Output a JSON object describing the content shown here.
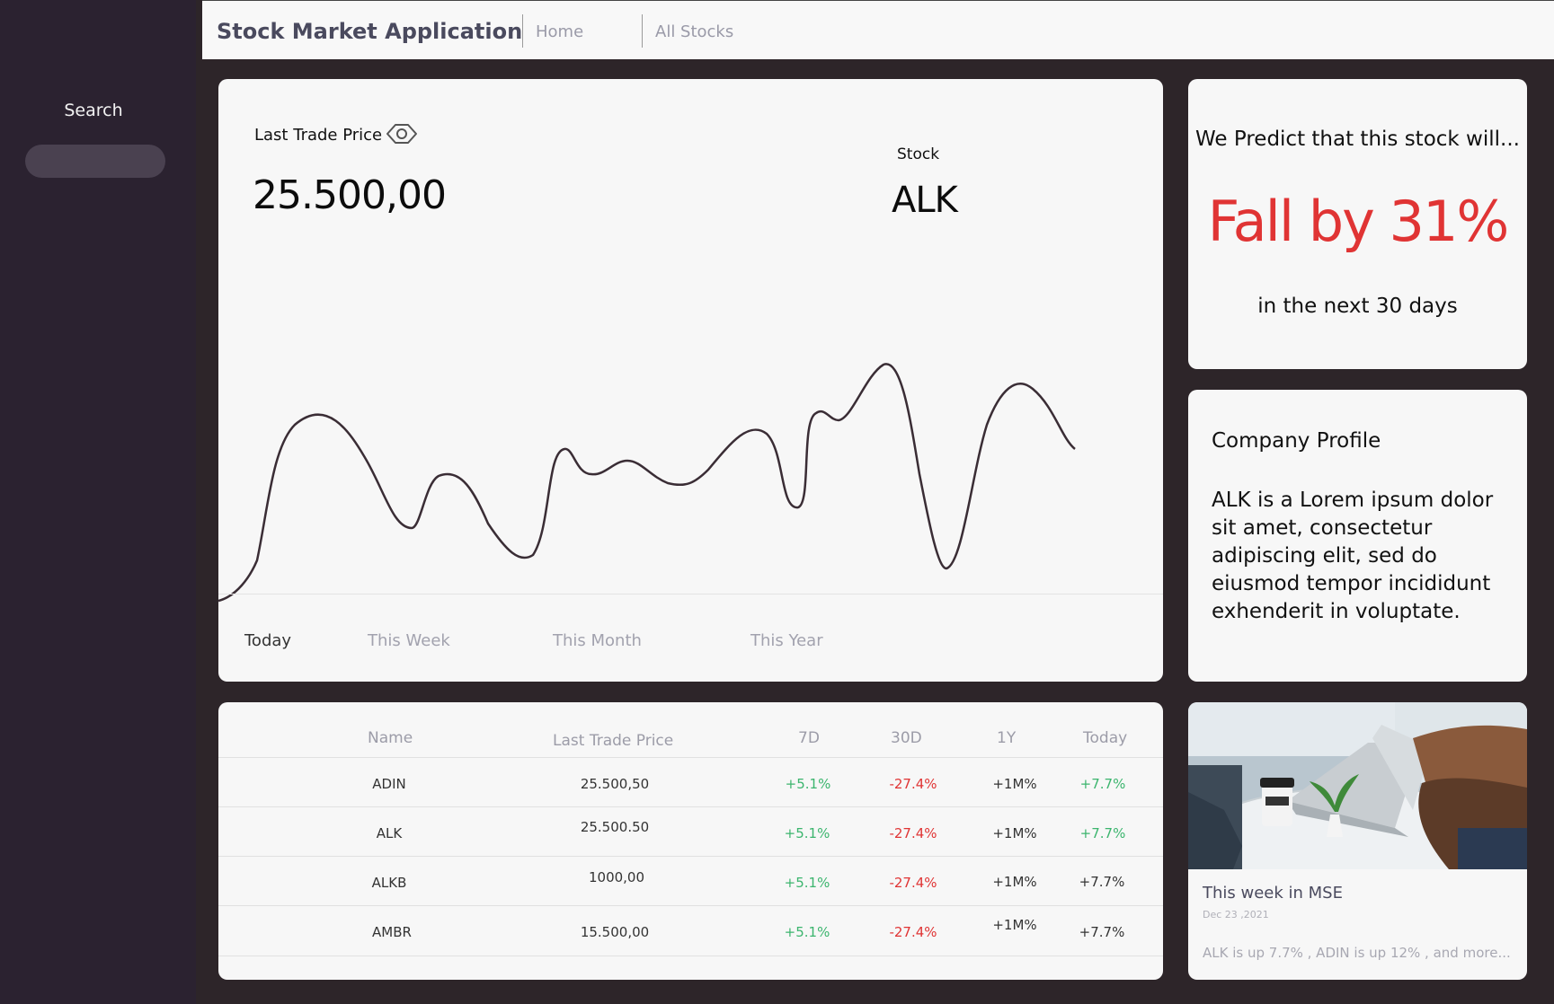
{
  "app": {
    "title": "Stock Market Application"
  },
  "nav": {
    "home": "Home",
    "all_stocks": "All Stocks"
  },
  "sidebar": {
    "search_label": "Search",
    "search_value": ""
  },
  "price_card": {
    "label": "Last Trade Price",
    "value": "25.500,00",
    "stock_label": "Stock",
    "stock_ticker": "ALK",
    "periods": [
      "Today",
      "This Week",
      "This Month",
      "This Year"
    ],
    "active_period": "Today"
  },
  "prediction": {
    "heading": "We Predict that this stock will...",
    "value": "Fall by 31%",
    "sub": "in the next 30 days"
  },
  "profile": {
    "title": "Company Profile",
    "text": "ALK is a Lorem ipsum dolor sit amet, consectetur adipiscing elit, sed do eiusmod tempor incididunt exhenderit in voluptate."
  },
  "table": {
    "headers": [
      "Name",
      "Last Trade Price",
      "7D",
      "30D",
      "1Y",
      "Today"
    ],
    "rows": [
      [
        "ADIN",
        "25.500,50",
        "+5.1%",
        "-27.4%",
        "+1M%",
        "+7.7%"
      ],
      [
        "ALK",
        "25.500.50",
        "+5.1%",
        "-27.4%",
        "+1M%",
        "+7.7%"
      ],
      [
        "ALKB",
        "1000,00",
        "+5.1%",
        "-27.4%",
        "+1M%",
        "+7.7%"
      ],
      [
        "AMBR",
        "15.500,00",
        "+5.1%",
        "-27.4%",
        "+1M%",
        "+7.7%"
      ]
    ],
    "today_colors": [
      "#3cb56e",
      "#3cb56e",
      "#333333",
      "#333333"
    ]
  },
  "news": {
    "title": "This week in MSE",
    "date": "Dec 23 ,2021",
    "summary": "ALK is up 7.7% , ADIN is up 12% , and more..."
  },
  "colors": {
    "positive": "#3cb56e",
    "negative": "#e03434",
    "accent_text": "#4a4a5e"
  },
  "icons": {
    "eye": "eye-icon"
  }
}
